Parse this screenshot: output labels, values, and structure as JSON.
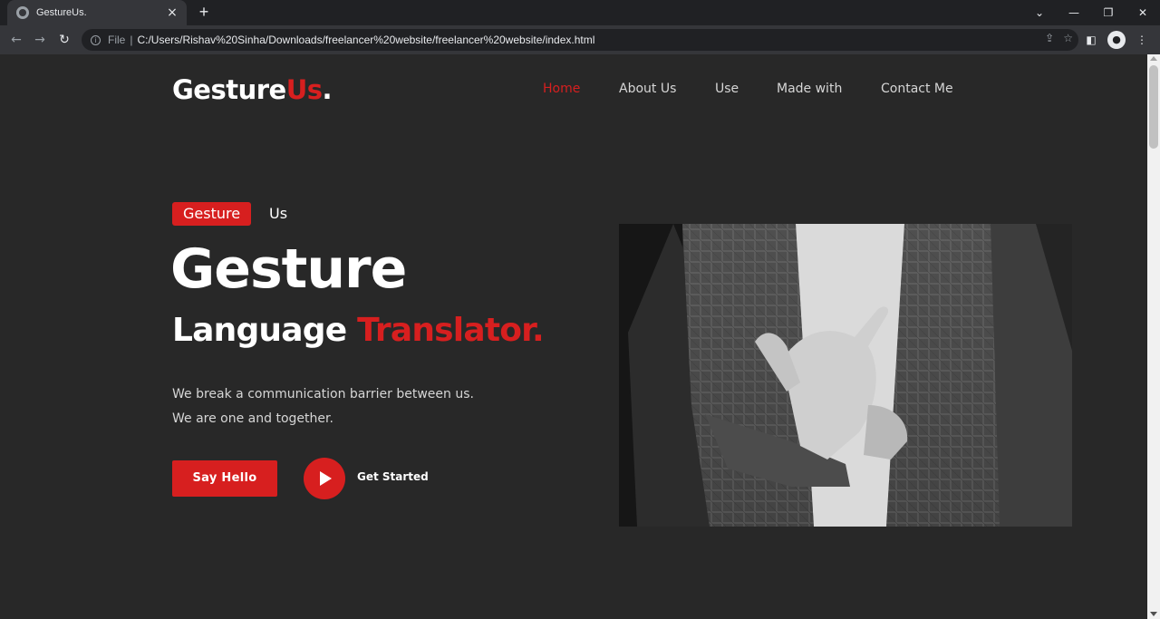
{
  "browser": {
    "tab_title": "GestureUs.",
    "tab_close": "×",
    "new_tab": "+",
    "scheme_label": "File",
    "separator": "|",
    "url": "C:/Users/Rishav%20Sinha/Downloads/freelancer%20website/freelancer%20website/index.html"
  },
  "site": {
    "logo_main": "Gesture",
    "logo_accent": "Us",
    "logo_dot": ".",
    "nav": [
      {
        "label": "Home",
        "active": true
      },
      {
        "label": "About Us",
        "active": false
      },
      {
        "label": "Use",
        "active": false
      },
      {
        "label": "Made with",
        "active": false
      },
      {
        "label": "Contact Me",
        "active": false
      }
    ]
  },
  "hero": {
    "badge": "Gesture",
    "badge_sub": "Us",
    "title": "Gesture",
    "subtitle_main": "Language ",
    "subtitle_accent": "Translator.",
    "desc_line1": "We break a communication barrier between us.",
    "desc_line2": "We are one and together.",
    "cta_primary": "Say Hello",
    "cta_secondary": "Get Started"
  },
  "colors": {
    "accent": "#d71f1f",
    "background": "#282828",
    "chrome_dark": "#202124",
    "chrome_mid": "#35363a"
  },
  "icons": {
    "favicon": "globe-icon",
    "back": "back-arrow-icon",
    "forward": "forward-arrow-icon",
    "reload": "reload-icon",
    "info": "info-icon",
    "share": "share-icon",
    "bookmark": "star-icon",
    "sidepanel": "side-panel-icon",
    "profile": "profile-icon",
    "menu": "kebab-menu-icon"
  }
}
